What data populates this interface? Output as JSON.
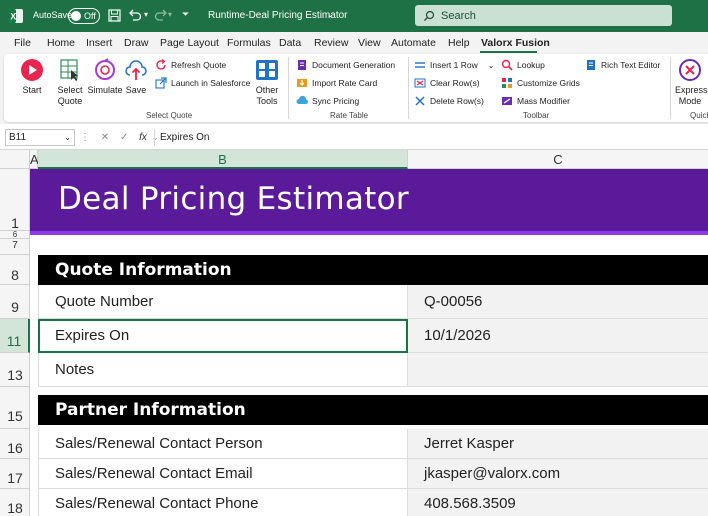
{
  "titlebar": {
    "autosave_label": "AutoSave",
    "autosave_state": "Off",
    "doc_title": "Runtime-Deal Pricing Estimator",
    "search_placeholder": "Search"
  },
  "tabs": [
    "File",
    "Home",
    "Insert",
    "Draw",
    "Page Layout",
    "Formulas",
    "Data",
    "Review",
    "View",
    "Automate",
    "Help",
    "Valorx Fusion"
  ],
  "active_tab": "Valorx Fusion",
  "ribbon": {
    "start": "Start",
    "select_quote": "Select Quote",
    "simulate": "Simulate",
    "save": "Save",
    "refresh_quote": "Refresh Quote",
    "launch_sf": "Launch in Salesforce",
    "other_tools": "Other Tools",
    "group_select_quote": "Select Quote",
    "doc_generation": "Document Generation",
    "import_rate_card": "Import Rate Card",
    "sync_pricing": "Sync Pricing",
    "group_rate_table": "Rate Table",
    "insert_row": "Insert 1 Row",
    "clear_rows": "Clear Row(s)",
    "delete_rows": "Delete Row(s)",
    "lookup": "Lookup",
    "customize_grids": "Customize Grids",
    "mass_modifier": "Mass Modifier",
    "rich_text": "Rich Text Editor",
    "group_toolbar": "Toolbar",
    "express_mode": "Express Mode",
    "group_quick": "Quick"
  },
  "formula_bar": {
    "name_box": "B11",
    "fx": "fx",
    "content": "Expires On"
  },
  "columns": [
    "A",
    "B",
    "C"
  ],
  "rows": [
    "1",
    "6",
    "7",
    "8",
    "9",
    "11",
    "13",
    "15",
    "16",
    "17",
    "18"
  ],
  "sheet": {
    "title": "Deal Pricing Estimator",
    "quote_section": "Quote Information",
    "quote_number_label": "Quote Number",
    "quote_number_value": "Q-00056",
    "expires_label": "Expires On",
    "expires_value": "10/1/2026",
    "notes_label": "Notes",
    "notes_value": "",
    "partner_section": "Partner Information",
    "contact_person_label": "Sales/Renewal Contact Person",
    "contact_person_value": "Jerret Kasper",
    "contact_email_label": "Sales/Renewal Contact Email",
    "contact_email_value": "jkasper@valorx.com",
    "contact_phone_label": "Sales/Renewal Contact Phone",
    "contact_phone_value": "408.568.3509"
  },
  "colors": {
    "excel_green": "#1e7145",
    "banner_purple": "#5a1a9a",
    "banner_strip": "#8a3bea"
  }
}
